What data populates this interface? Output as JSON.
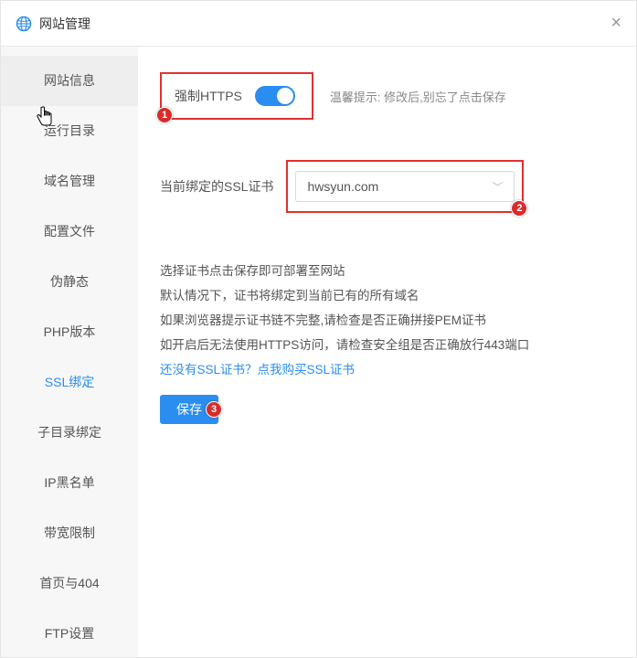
{
  "header": {
    "title": "网站管理"
  },
  "sidebar": {
    "items": [
      {
        "label": "网站信息"
      },
      {
        "label": "运行目录"
      },
      {
        "label": "域名管理"
      },
      {
        "label": "配置文件"
      },
      {
        "label": "伪静态"
      },
      {
        "label": "PHP版本"
      },
      {
        "label": "SSL绑定"
      },
      {
        "label": "子目录绑定"
      },
      {
        "label": "IP黑名单"
      },
      {
        "label": "带宽限制"
      },
      {
        "label": "首页与404"
      },
      {
        "label": "FTP设置"
      }
    ],
    "active_index": 6
  },
  "content": {
    "force_https_label": "强制HTTPS",
    "force_https_on": true,
    "tip": "温馨提示: 修改后,别忘了点击保存",
    "current_ssl_label": "当前绑定的SSL证书",
    "select_value": "hwsyun.com",
    "info_lines": [
      "选择证书点击保存即可部署至网站",
      "默认情况下，证书将绑定到当前已有的所有域名",
      "如果浏览器提示证书链不完整,请检查是否正确拼接PEM证书",
      "如开启后无法使用HTTPS访问，请检查安全组是否正确放行443端口"
    ],
    "link_text": "还没有SSL证书？点我购买SSL证书",
    "save_label": "保存"
  },
  "markers": {
    "one": "1",
    "two": "2",
    "three": "3"
  }
}
